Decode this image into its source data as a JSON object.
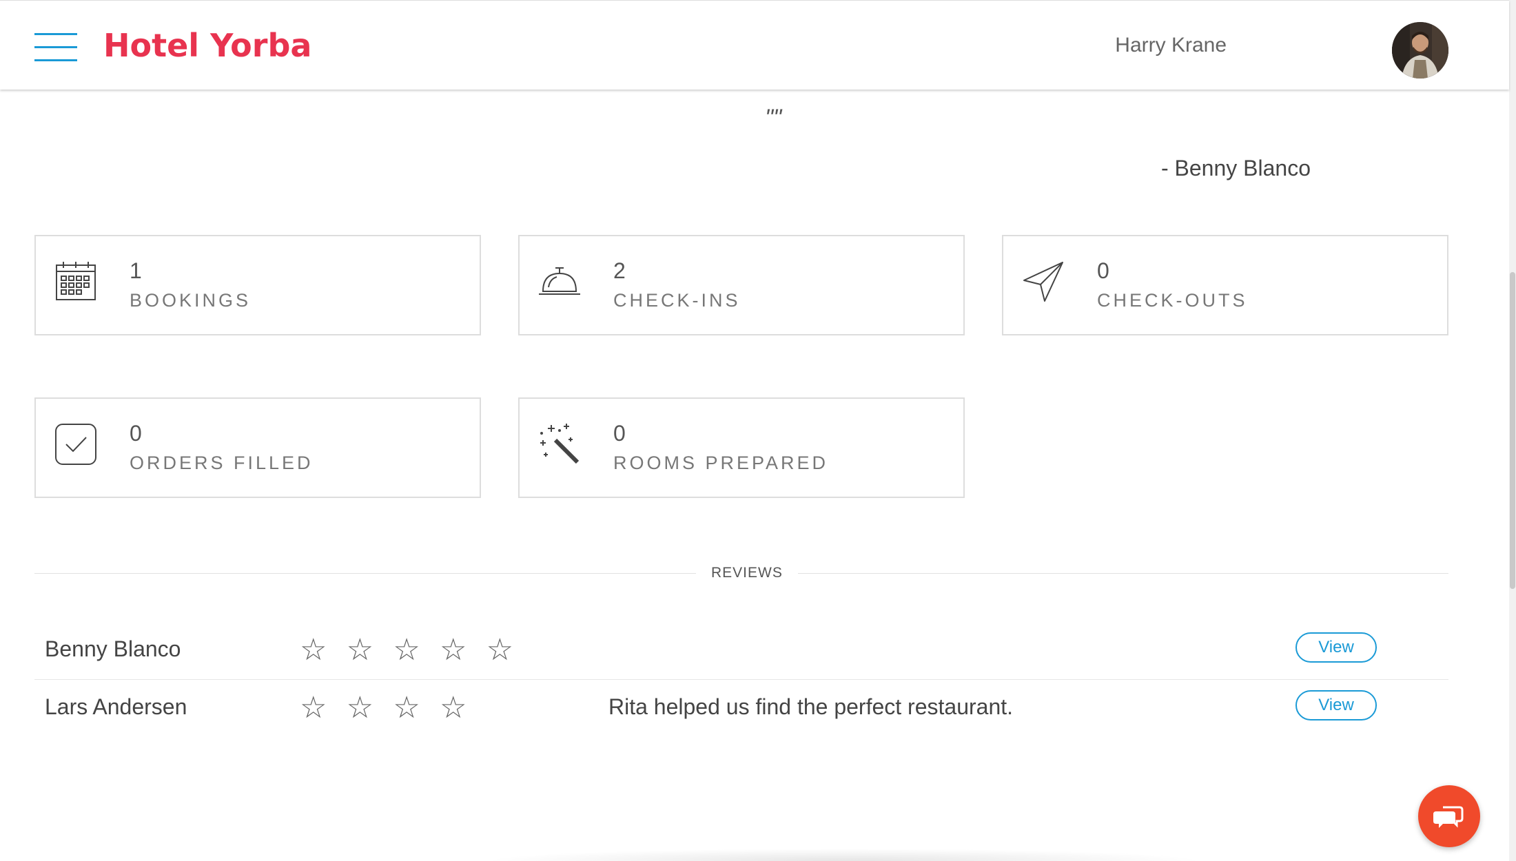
{
  "header": {
    "brand": "Hotel Yorba",
    "user_name": "Harry Krane",
    "menu_icon": "hamburger-menu-icon",
    "brand_color": "#e8334f",
    "accent_color": "#1a9ad6"
  },
  "quote": {
    "text": "\"\"",
    "author": "- Benny Blanco"
  },
  "stats": [
    {
      "value": "1",
      "label": "BOOKINGS",
      "icon": "calendar-icon"
    },
    {
      "value": "2",
      "label": "CHECK-INS",
      "icon": "service-bell-icon"
    },
    {
      "value": "0",
      "label": "CHECK-OUTS",
      "icon": "paper-plane-icon"
    },
    {
      "value": "0",
      "label": "ORDERS FILLED",
      "icon": "checkmark-box-icon"
    },
    {
      "value": "0",
      "label": "ROOMS PREPARED",
      "icon": "magic-wand-icon"
    }
  ],
  "reviews": {
    "title": "REVIEWS",
    "items": [
      {
        "name": "Benny Blanco",
        "stars": "☆ ☆ ☆ ☆ ☆",
        "star_count": 5,
        "comment": "",
        "action": "View"
      },
      {
        "name": "Lars Andersen",
        "stars": "☆ ☆ ☆ ☆",
        "star_count": 4,
        "comment": "Rita helped us find the perfect restaurant.",
        "action": "View"
      }
    ]
  },
  "chat": {
    "icon": "chat-bubbles-icon",
    "color": "#f04a2b"
  }
}
